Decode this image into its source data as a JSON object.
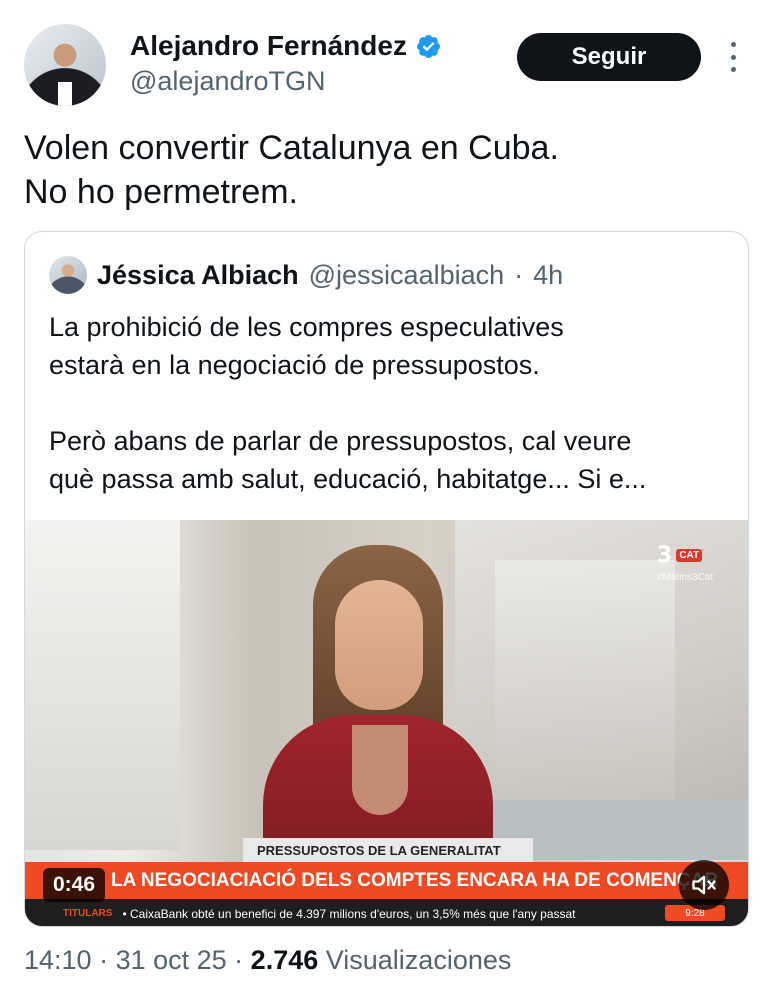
{
  "author": {
    "name": "Alejandro Fernández",
    "handle": "@alejandroTGN",
    "verified": true,
    "follow_label": "Seguir"
  },
  "tweet": {
    "lines": [
      "Volen convertir Catalunya en Cuba.",
      "No ho permetrem."
    ]
  },
  "quote": {
    "name": "Jéssica Albiach",
    "handle": "@jessicaalbiach",
    "separator": "·",
    "time": "4h",
    "text_lines": [
      "La prohibició de les compres especulatives",
      "estarà en la negociació de pressupostos.",
      "Però abans de parlar de pressupostos, cal veure",
      "què passa amb salut, educació, habitatge... Si e..."
    ],
    "video": {
      "duration": "0:46",
      "channel_logo": "3",
      "channel_badge": "CAT",
      "channel_tag": "#Matins3Cat",
      "caption": "PRESSUPOSTOS DE LA GENERALITAT",
      "headline": "LA NEGOCIACIACIÓ DELS COMPTES ENCARA HA DE COMENÇAR",
      "ticker_label": "TITULARS",
      "ticker_text": "• CaixaBank obté un benefici de 4.397 milions d'euros, un 3,5% més que l'any passat",
      "ticker_time": "9:28",
      "mute_icon": "speaker-muted-icon"
    }
  },
  "footer": {
    "time": "14:10",
    "sep1": " · ",
    "date": "31 oct 25",
    "sep2": " · ",
    "views_count": "2.746",
    "views_label": " Visualizaciones"
  },
  "colors": {
    "text": "#0f1419",
    "secondary": "#536471",
    "verified": "#1d9bf0",
    "banner": "#ef4a23"
  }
}
